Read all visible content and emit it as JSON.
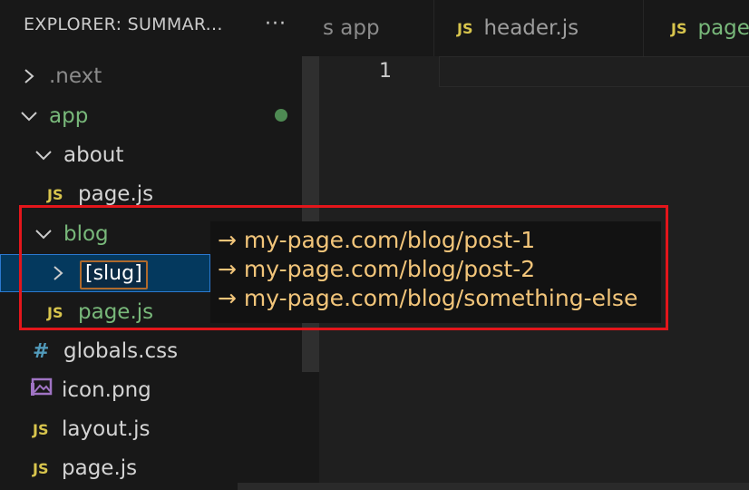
{
  "sidebar": {
    "title": "EXPLORER: SUMMAR...",
    "more_icon": "···",
    "tree": {
      "next": ".next",
      "app": "app",
      "about": "about",
      "about_page": "page.js",
      "blog": "blog",
      "slug": "[slug]",
      "blog_page": "page.js",
      "globals": "globals.css",
      "icon": "icon.png",
      "layout": "layout.js",
      "root_page": "page.js"
    },
    "js_badge": "JS",
    "hash_badge": "#"
  },
  "tabs": {
    "tab1": "s app",
    "tab2": "header.js",
    "tab3": "page",
    "js_badge": "JS"
  },
  "editor": {
    "line_number": "1"
  },
  "callout": {
    "line1": "→ my-page.com/blog/post-1",
    "line2": "→ my-page.com/blog/post-2",
    "line3": "→ my-page.com/blog/something-else"
  },
  "colors": {
    "accent_red": "#e3161b",
    "callout_text": "#f2c57a",
    "folder_green": "#78b87a",
    "js_yellow": "#d8c54d",
    "selection_blue": "#04395e"
  }
}
